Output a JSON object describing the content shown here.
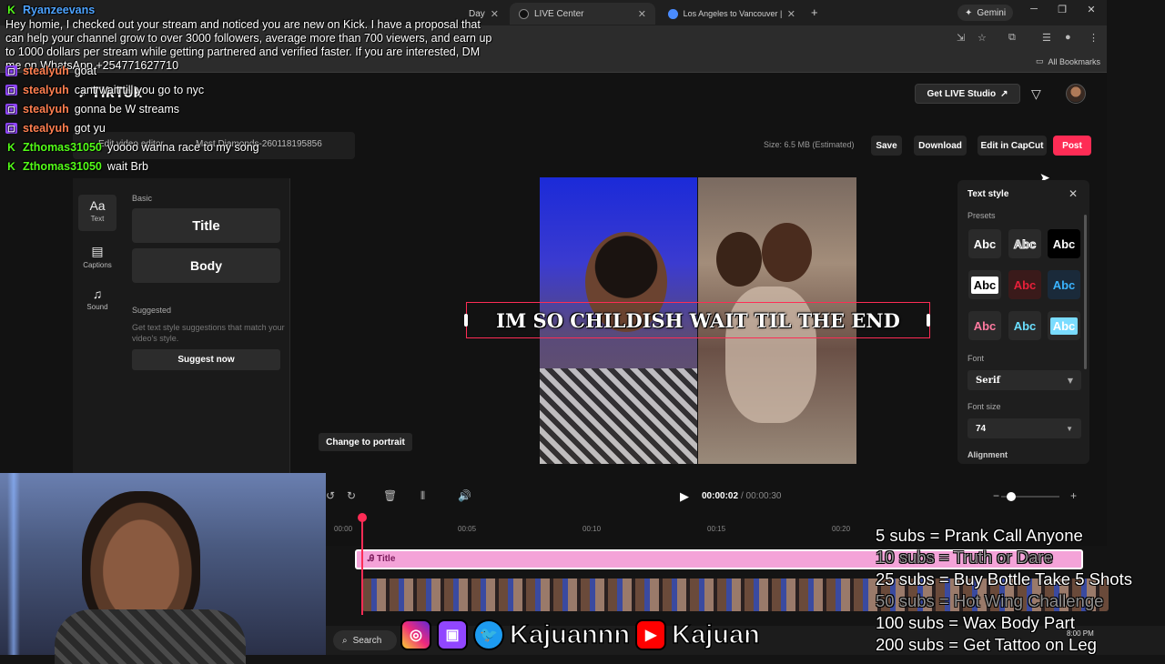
{
  "browser": {
    "tabs": [
      {
        "label": "TikTok LIVE Center",
        "short": "LIVE Center"
      },
      {
        "label": "Los Angeles to Vancouver | Go"
      },
      {
        "label": "Day"
      }
    ],
    "gemini_label": "Gemini",
    "bookmarks_label": "All Bookmarks"
  },
  "tiktok": {
    "logo": "TikTok",
    "get_live_studio": "Get LIVE Studio",
    "breadcrumb_editor": "Edit video editor",
    "breadcrumb_file": "Most Diamonds-260118195856",
    "size_label": "Size: 6.5 MB (Estimated)",
    "buttons": {
      "save": "Save",
      "download": "Download",
      "capcut": "Edit in CapCut",
      "post": "Post"
    },
    "rail": [
      {
        "label": "Text",
        "icon": "Aa"
      },
      {
        "label": "Captions",
        "icon": "captions-icon"
      },
      {
        "label": "Sound",
        "icon": "music-note-icon"
      }
    ],
    "panel": {
      "basic_label": "Basic",
      "title_preset": "Title",
      "body_preset": "Body",
      "suggested_label": "Suggested",
      "suggest_desc": "Get text style suggestions that match your video's style.",
      "suggest_btn": "Suggest now"
    },
    "caption_text": "IM SO CHILDISH WAIT TIL THE END",
    "change_portrait": "Change to portrait",
    "text_style": {
      "title": "Text style",
      "presets_label": "Presets",
      "preset_sample": "Abc",
      "font_label": "Font",
      "font_value": "Serif",
      "font_size_label": "Font size",
      "font_size_value": "74",
      "alignment_label": "Alignment"
    },
    "timeline": {
      "current_time": "00:00:02",
      "total_time": "/ 00:00:30",
      "ruler": [
        "00:00",
        "00:05",
        "00:10",
        "00:15",
        "00:20"
      ],
      "title_track": "Title"
    }
  },
  "chat": {
    "long_message_user": "Ryanzeevans",
    "long_message": "Hey homie, I checked out your stream and noticed you are new on Kick. I have a proposal that can help your channel grow to over 3000 followers, average more than 700 viewers, and earn up to 1000 dollars per stream while getting partnered and verified faster. If you are interested, DM me on WhatsApp +254771627710",
    "lines": [
      {
        "platform": "twitch",
        "user": "stealyuh",
        "text": "goat"
      },
      {
        "platform": "twitch",
        "user": "stealyuh",
        "text": "cant wait till you go to nyc"
      },
      {
        "platform": "twitch",
        "user": "stealyuh",
        "text": "gonna be W streams"
      },
      {
        "platform": "twitch",
        "user": "stealyuh",
        "text": "got yu"
      },
      {
        "platform": "kick",
        "user": "Zthomas31050",
        "text": "yoooo wanna race to my song"
      },
      {
        "platform": "kick",
        "user": "Zthomas31050",
        "text": "wait Brb"
      }
    ],
    "colors": {
      "twitch_user": "#ff7f50",
      "kick_user": "#53fc18",
      "ryan_user": "#4da3ff"
    }
  },
  "overlay": {
    "social_name_1": "Kajuannn",
    "social_name_2": "Kajuan",
    "sub_goals": [
      "5 subs =  Prank Call Anyone",
      "10 subs = Truth or Dare",
      "25 subs = Buy Bottle Take 5 Shots",
      "50 subs = Hot Wing Challenge",
      "100 subs = Wax Body Part",
      "200 subs = Get Tattoo on Leg"
    ]
  },
  "taskbar": {
    "search_label": "Search",
    "clock_time": "8:00 PM"
  },
  "colors": {
    "accent": "#fe2c55",
    "track": "#f4a3d8"
  }
}
